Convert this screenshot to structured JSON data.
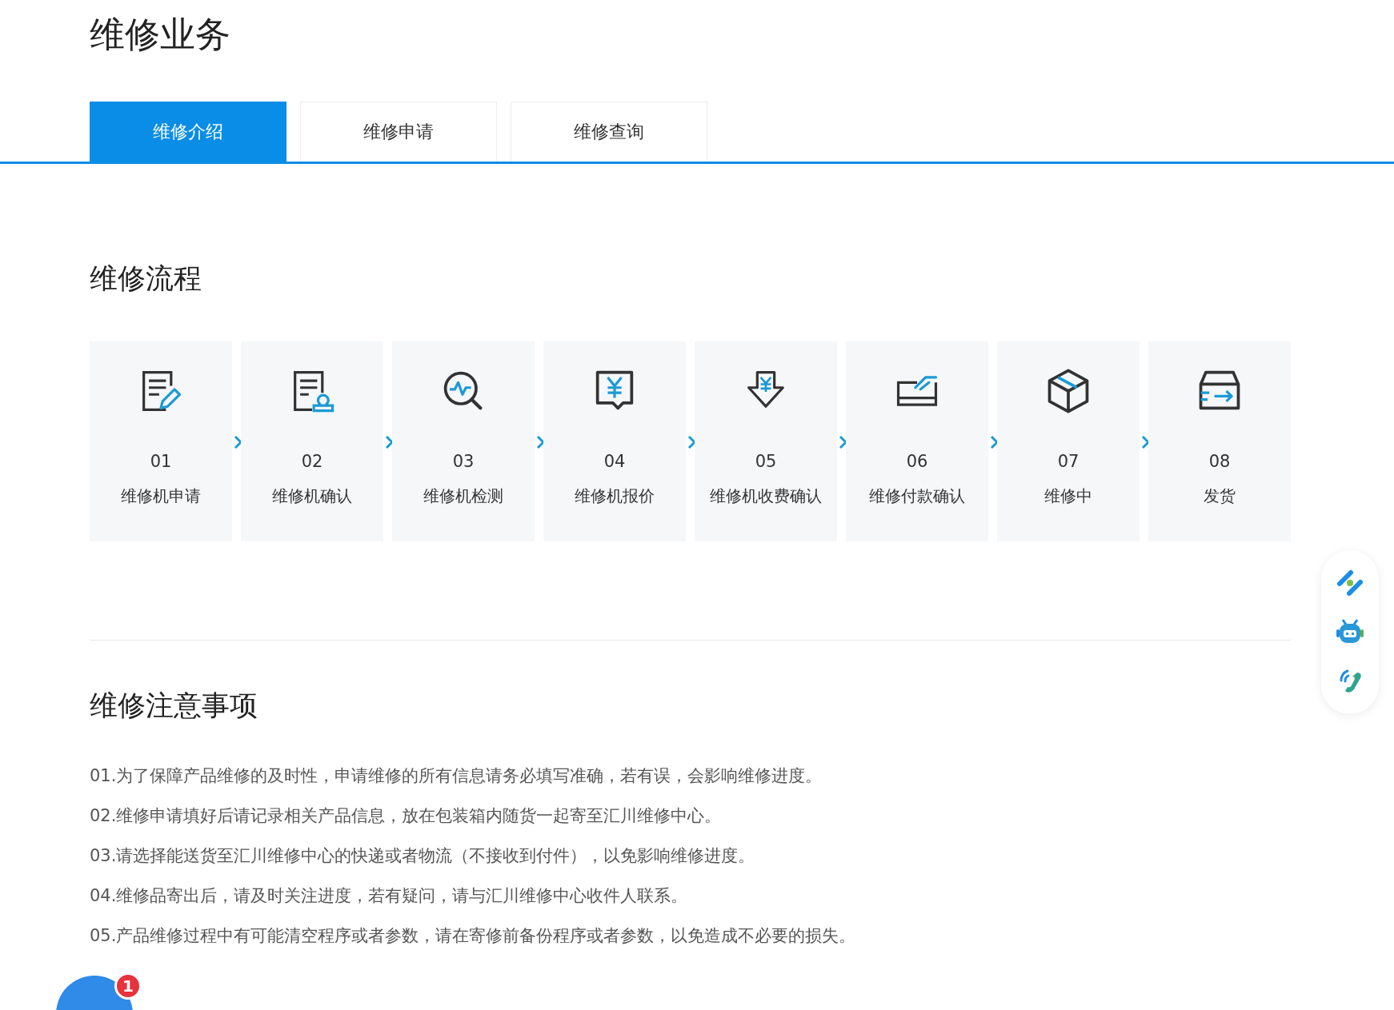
{
  "page_title": "维修业务",
  "tabs": [
    {
      "label": "维修介绍",
      "selected": true
    },
    {
      "label": "维修申请",
      "selected": false
    },
    {
      "label": "维修查询",
      "selected": false
    }
  ],
  "process": {
    "title": "维修流程",
    "steps": [
      {
        "number": "01",
        "label": "维修机申请",
        "kind": "form"
      },
      {
        "number": "02",
        "label": "维修机确认",
        "kind": "stamp"
      },
      {
        "number": "03",
        "label": "维修机检测",
        "kind": "inspect"
      },
      {
        "number": "04",
        "label": "维修机报价",
        "kind": "quote"
      },
      {
        "number": "05",
        "label": "维修机收费确认",
        "kind": "charge"
      },
      {
        "number": "06",
        "label": "维修付款确认",
        "kind": "pay"
      },
      {
        "number": "07",
        "label": "维修中",
        "kind": "box"
      },
      {
        "number": "08",
        "label": "发货",
        "kind": "ship"
      }
    ]
  },
  "notes": {
    "title": "维修注意事项",
    "items": [
      "01.为了保障产品维修的及时性，申请维修的所有信息请务必填写准确，若有误，会影响维修进度。",
      "02.维修申请填好后请记录相关产品信息，放在包装箱内随货一起寄至汇川维修中心。",
      "03.请选择能送货至汇川维修中心的快递或者物流（不接收到付件），以免影响维修进度。",
      "04.维修品寄出后，请及时关注进度，若有疑问，请与汇川维修中心收件人联系。",
      "05.产品维修过程中有可能清空程序或者参数，请在寄修前备份程序或者参数，以免造成不必要的损失。"
    ]
  },
  "chat_badge": "1"
}
